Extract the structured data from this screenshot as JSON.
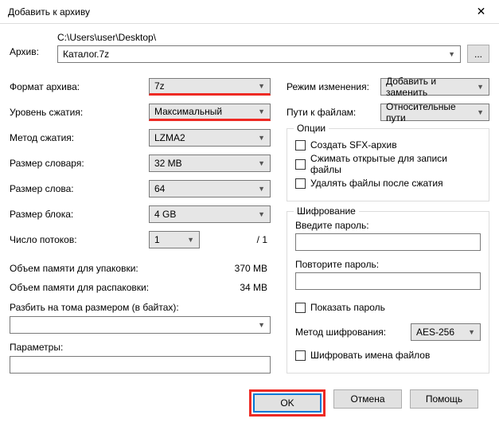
{
  "window": {
    "title": "Добавить к архиву",
    "close": "✕"
  },
  "archive": {
    "label": "Архив:",
    "path": "C:\\Users\\user\\Desktop\\",
    "name": "Каталог.7z",
    "browse": "..."
  },
  "left": {
    "format_label": "Формат архива:",
    "format_value": "7z",
    "level_label": "Уровень сжатия:",
    "level_value": "Максимальный",
    "method_label": "Метод сжатия:",
    "method_value": "LZMA2",
    "dict_label": "Размер словаря:",
    "dict_value": "32 MB",
    "word_label": "Размер слова:",
    "word_value": "64",
    "block_label": "Размер блока:",
    "block_value": "4 GB",
    "threads_label": "Число потоков:",
    "threads_value": "1",
    "threads_total": "/ 1",
    "mem_pack_label": "Объем памяти для упаковки:",
    "mem_pack_value": "370 MB",
    "mem_unpack_label": "Объем памяти для распаковки:",
    "mem_unpack_value": "34 MB",
    "split_label": "Разбить на тома размером (в байтах):",
    "params_label": "Параметры:"
  },
  "right": {
    "update_label": "Режим изменения:",
    "update_value": "Добавить и заменить",
    "paths_label": "Пути к файлам:",
    "paths_value": "Относительные пути",
    "options_title": "Опции",
    "opt_sfx": "Создать SFX-архив",
    "opt_compress_open": "Сжимать открытые для записи файлы",
    "opt_delete": "Удалять файлы после сжатия",
    "enc_title": "Шифрование",
    "enc_pass_label": "Введите пароль:",
    "enc_repass_label": "Повторите пароль:",
    "enc_show": "Показать пароль",
    "enc_method_label": "Метод шифрования:",
    "enc_method_value": "AES-256",
    "enc_names": "Шифровать имена файлов"
  },
  "buttons": {
    "ok": "OK",
    "cancel": "Отмена",
    "help": "Помощь"
  }
}
